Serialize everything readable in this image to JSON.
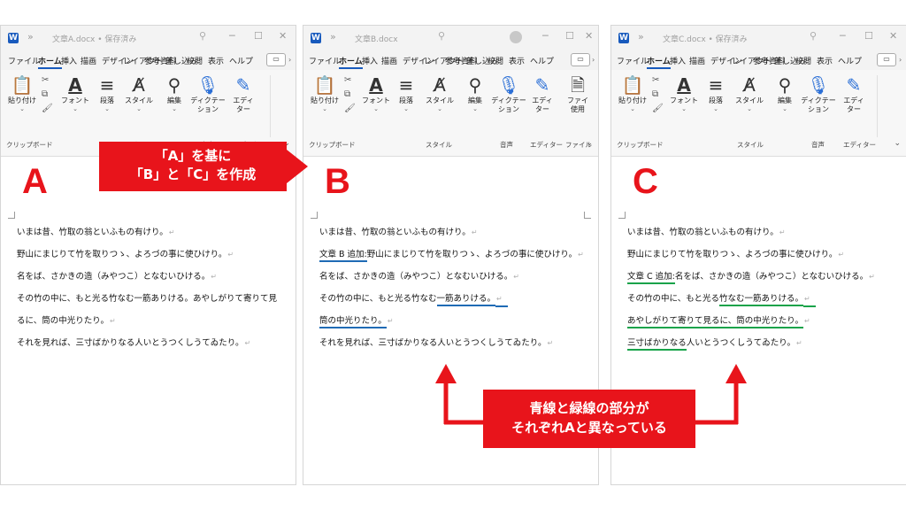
{
  "windows": [
    {
      "title": "文章A.docx • 保存済み",
      "letter": "A",
      "show_avatar": false,
      "lines": [
        {
          "parts": [
            {
              "t": "いまは昔、竹取の翁といふもの有けり。",
              "u": ""
            }
          ]
        },
        {
          "parts": [
            {
              "t": "野山にまじりて竹を取りつゝ、よろづの事に使ひけり。",
              "u": ""
            }
          ]
        },
        {
          "parts": [
            {
              "t": "名をば、さかきの造（みやつこ）となむいひける。",
              "u": ""
            }
          ]
        },
        {
          "parts": [
            {
              "t": "その竹の中に、もと光る竹なむ一筋ありける。あやしがりて寄りて見",
              "u": ""
            }
          ],
          "nomark": true
        },
        {
          "parts": [
            {
              "t": "るに、筒の中光りたり。",
              "u": ""
            }
          ]
        },
        {
          "parts": [
            {
              "t": "それを見れば、三寸ばかりなる人いとうつくしうてゐたり。",
              "u": ""
            }
          ]
        }
      ]
    },
    {
      "title": "文章B.docx",
      "letter": "B",
      "show_avatar": true,
      "lines": [
        {
          "parts": [
            {
              "t": "いまは昔、竹取の翁といふもの有けり。",
              "u": ""
            }
          ]
        },
        {
          "parts": [
            {
              "t": "文章 B 追加:",
              "u": "blue"
            },
            {
              "t": "野山にまじりて竹を取りつゝ、よろづの事に使ひけり。",
              "u": ""
            }
          ]
        },
        {
          "parts": [
            {
              "t": "名をば、さかきの造（みやつこ）となむいひける。",
              "u": ""
            }
          ]
        },
        {
          "parts": [
            {
              "t": "その竹の中に、もと光る竹なむ",
              "u": ""
            },
            {
              "t": "一筋ありける。",
              "u": "blue"
            }
          ],
          "ext": "blue"
        },
        {
          "parts": [
            {
              "t": "筒の中光りたり。",
              "u": "blue"
            }
          ]
        },
        {
          "parts": [
            {
              "t": "それを見れば、三寸ばかりなる人いとうつくしうてゐたり。",
              "u": ""
            }
          ]
        }
      ]
    },
    {
      "title": "文章C.docx • 保存済み",
      "letter": "C",
      "show_avatar": false,
      "lines": [
        {
          "parts": [
            {
              "t": "いまは昔、竹取の翁といふもの有けり。",
              "u": ""
            }
          ]
        },
        {
          "parts": [
            {
              "t": "野山にまじりて竹を取りつゝ、よろづの事に使ひけり。",
              "u": ""
            }
          ]
        },
        {
          "parts": [
            {
              "t": "文章 C 追加:",
              "u": "green"
            },
            {
              "t": "名をば、さかきの造（みやつこ）となむいひける。",
              "u": ""
            }
          ]
        },
        {
          "parts": [
            {
              "t": "その竹の中に、もと光る",
              "u": ""
            },
            {
              "t": "竹なむ一筋ありける。",
              "u": "green"
            }
          ],
          "ext": "green"
        },
        {
          "parts": [
            {
              "t": "あやしがりて寄りて見るに、筒の中光りたり。",
              "u": "green"
            }
          ]
        },
        {
          "parts": [
            {
              "t": "三寸ばかりなる",
              "u": "green"
            },
            {
              "t": "人いとうつくしうてゐたり。",
              "u": ""
            }
          ]
        }
      ]
    }
  ],
  "tabs": [
    "ファイル",
    "ホーム",
    "挿入",
    "描画",
    "デザイン",
    "レイアウト",
    "参考資料",
    "差し込み",
    "校閲",
    "表示",
    "ヘルプ"
  ],
  "ribbon": {
    "paste": "貼り付け",
    "font": "フォント",
    "paragraph": "段落",
    "style": "スタイル",
    "edit": "編集",
    "dictation": "ディクテー",
    "dictation2": "ション",
    "editor": "エディ",
    "editor2": "ター",
    "files": "ファイ",
    "files2": "使用",
    "groups": {
      "clipboard": "クリップボード",
      "style": "スタイル",
      "voice": "音声",
      "editor": "エディター",
      "file": "ファイル"
    }
  },
  "icons": {
    "app": "word-app-icon",
    "search": "search-icon",
    "minimize": "minimize-icon",
    "maximize": "maximize-icon",
    "close": "close-icon",
    "comment": "comment-icon"
  },
  "callout_top": {
    "line1": "「A」を基に",
    "line2": "「B」と「C」を作成"
  },
  "callout_bottom": {
    "line1": "青線と緑線の部分が",
    "line2": "それぞれAと異なっている"
  },
  "colors": {
    "red": "#e8141b",
    "blue_underline": "#1f6bb5",
    "green_underline": "#19a34a",
    "word_blue": "#185abd"
  }
}
